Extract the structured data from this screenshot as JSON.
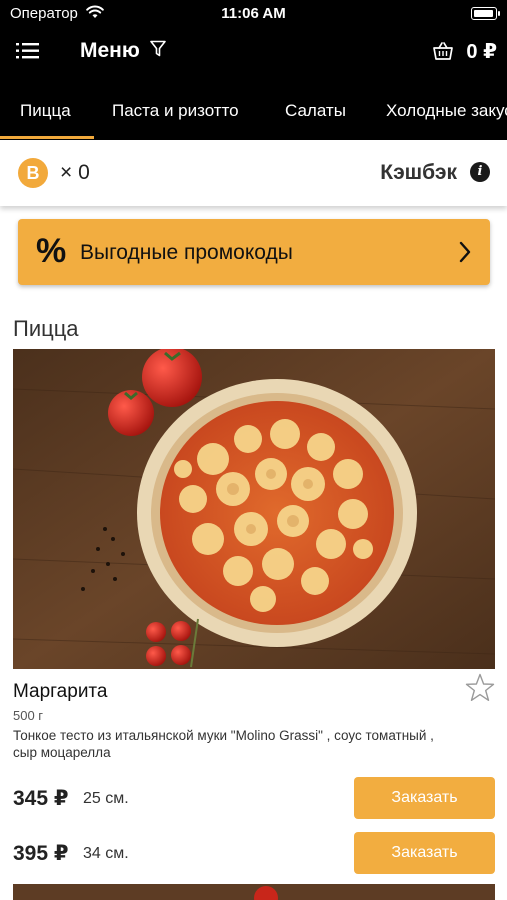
{
  "status_bar": {
    "carrier": "Оператор",
    "time": "11:06 AM"
  },
  "navbar": {
    "title": "Меню",
    "cart_total": "0 ₽"
  },
  "tabs": [
    "Пицца",
    "Паста и ризотто",
    "Салаты",
    "Холодные закуски"
  ],
  "cashback": {
    "coin_letter": "B",
    "count": "× 0",
    "label": "Кэшбэк",
    "info_glyph": "i"
  },
  "promo": {
    "icon_glyph": "%",
    "label": "Выгодные промокоды"
  },
  "section": {
    "title": "Пицца"
  },
  "product": {
    "name": "Маргарита",
    "weight": "500 г",
    "description": "Тонкое тесто из итальянской муки \"Molino Grassi\" , соус томатный , сыр моцарелла",
    "variants": [
      {
        "price": "345 ₽",
        "size": "25 см.",
        "button": "Заказать"
      },
      {
        "price": "395 ₽",
        "size": "34 см.",
        "button": "Заказать"
      }
    ]
  },
  "colors": {
    "accent": "#f2ad40",
    "tab_underline": "#f2a93b",
    "bar_bg": "#000000"
  },
  "icons": [
    "wifi-icon",
    "battery-icon",
    "menu-icon",
    "filter-icon",
    "basket-icon",
    "coin-icon",
    "info-icon",
    "percent-icon",
    "chevron-right-icon",
    "star-icon"
  ]
}
